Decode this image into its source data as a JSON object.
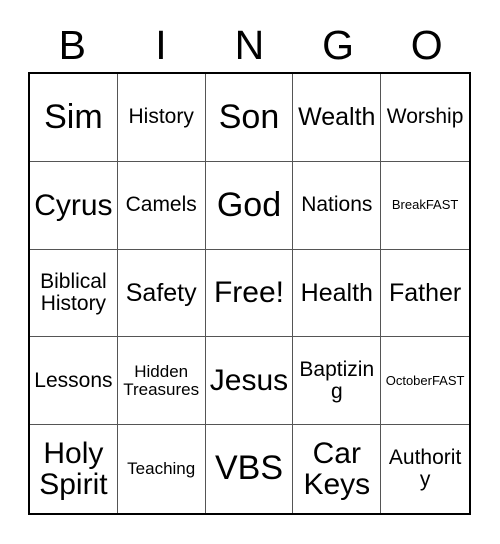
{
  "card": {
    "type": "bingo-card",
    "header": {
      "letters": [
        "B",
        "I",
        "N",
        "G",
        "O"
      ]
    },
    "grid": {
      "rows": 5,
      "columns": 5,
      "free_space": "Free!",
      "cells": [
        {
          "text": "Sim",
          "size": "xxl"
        },
        {
          "text": "History",
          "size": "md"
        },
        {
          "text": "Son",
          "size": "xxl"
        },
        {
          "text": "Wealth",
          "size": "lg"
        },
        {
          "text": "Worship",
          "size": "md"
        },
        {
          "text": "Cyrus",
          "size": "xl"
        },
        {
          "text": "Camels",
          "size": "md"
        },
        {
          "text": "God",
          "size": "xxl"
        },
        {
          "text": "Nations",
          "size": "md"
        },
        {
          "text": "BreakFAST",
          "size": "xs"
        },
        {
          "text": "Biblical\nHistory",
          "size": "md"
        },
        {
          "text": "Safety",
          "size": "lg"
        },
        {
          "text": "Free!",
          "size": "xl"
        },
        {
          "text": "Health",
          "size": "lg"
        },
        {
          "text": "Father",
          "size": "lg"
        },
        {
          "text": "Lessons",
          "size": "md"
        },
        {
          "text": "Hidden\nTreasures",
          "size": "sm"
        },
        {
          "text": "Jesus",
          "size": "xl"
        },
        {
          "text": "Baptizing",
          "size": "md"
        },
        {
          "text": "OctoberFAST",
          "size": "xs"
        },
        {
          "text": "Holy\nSpirit",
          "size": "xl"
        },
        {
          "text": "Teaching",
          "size": "sm"
        },
        {
          "text": "VBS",
          "size": "xxl"
        },
        {
          "text": "Car\nKeys",
          "size": "xl"
        },
        {
          "text": "Authority",
          "size": "md"
        }
      ]
    },
    "colors": {
      "background": "#ffffff",
      "text": "#000000",
      "outer_border": "#000000",
      "inner_grid_line": "#555555"
    }
  }
}
